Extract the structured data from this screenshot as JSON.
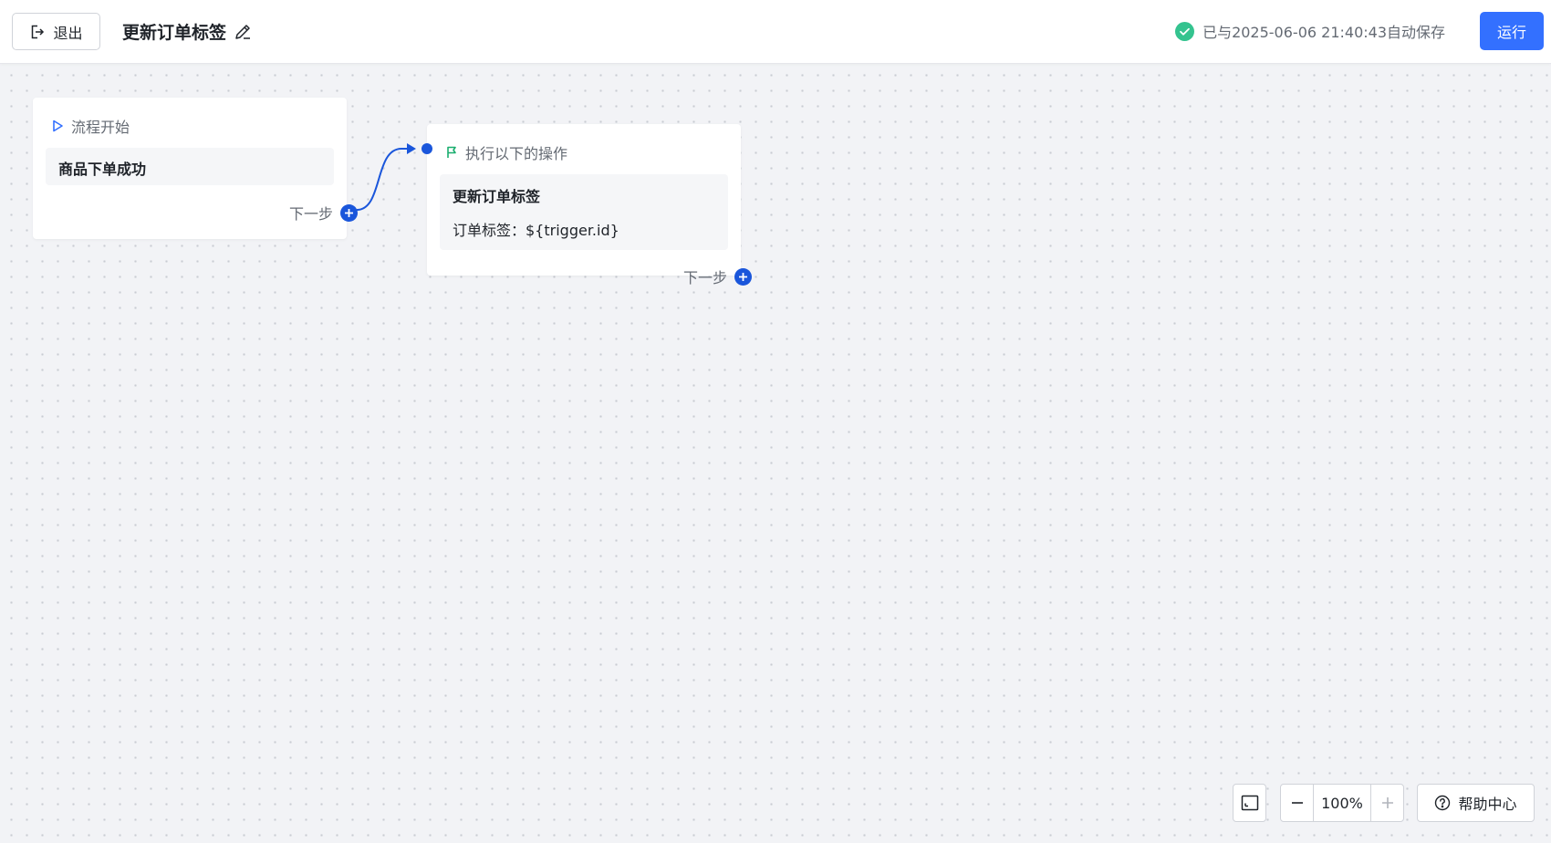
{
  "header": {
    "exit_label": "退出",
    "title": "更新订单标签",
    "save_status": "已与2025-06-06 21:40:43自动保存",
    "run_label": "运行"
  },
  "canvas": {
    "start_node": {
      "header": "流程开始",
      "trigger": "商品下单成功",
      "next_label": "下一步"
    },
    "action_node": {
      "header": "执行以下的操作",
      "action_title": "更新订单标签",
      "action_detail": "订单标签：${trigger.id}",
      "next_label": "下一步"
    }
  },
  "controls": {
    "zoom_level": "100%",
    "help_label": "帮助中心"
  },
  "icons": {
    "exit": "exit-icon",
    "edit": "pencil-icon",
    "saved": "check-circle-icon",
    "start": "play-outline-icon",
    "action": "flag-icon",
    "next": "plus-circle-icon",
    "fit": "fit-view-icon",
    "zoom_out": "minus-icon",
    "zoom_in": "plus-icon",
    "help": "question-circle-icon"
  },
  "colors": {
    "primary": "#3370ff",
    "connector": "#1a56db",
    "success": "#34c38f",
    "flag": "#1aae6f",
    "canvas_bg": "#f2f3f6"
  }
}
